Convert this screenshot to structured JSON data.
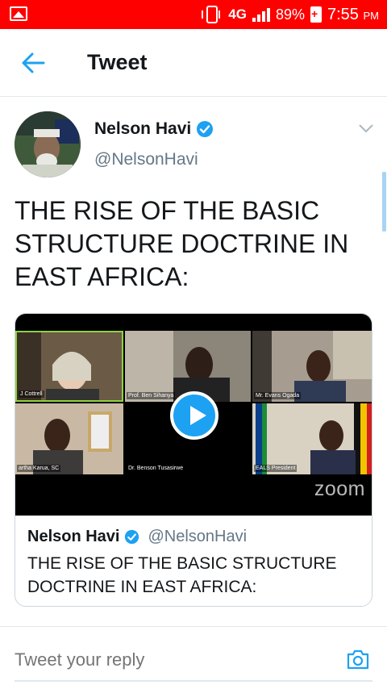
{
  "status_bar": {
    "network": "4G",
    "battery_percent": "89%",
    "time": "7:55",
    "ampm": "PM",
    "icons": [
      "gallery-icon",
      "vibrate-icon",
      "signal-icon",
      "battery-charging-icon"
    ]
  },
  "header": {
    "title": "Tweet",
    "back_icon": "arrow-left-icon"
  },
  "author": {
    "name": "Nelson Havi",
    "handle": "@NelsonHavi",
    "verified": true
  },
  "tweet": {
    "text": "THE RISE OF THE BASIC STRUCTURE DOCTRINE IN EAST AFRICA:"
  },
  "media": {
    "logo": "zoom",
    "participants": [
      "J Cottrell",
      "Prof. Ben Sihanya",
      "Mr. Evans Ogada",
      "artha Karua, SC",
      "Dr. Benson Tusasirwe",
      "EALS President"
    ]
  },
  "quoted": {
    "name": "Nelson Havi",
    "handle": "@NelsonHavi",
    "text": "THE RISE OF THE BASIC STRUCTURE DOCTRINE IN EAST AFRICA:"
  },
  "reply": {
    "placeholder": "Tweet your reply"
  },
  "colors": {
    "accent": "#1da1f2",
    "status_bar": "#ff0000",
    "muted": "#657786"
  }
}
